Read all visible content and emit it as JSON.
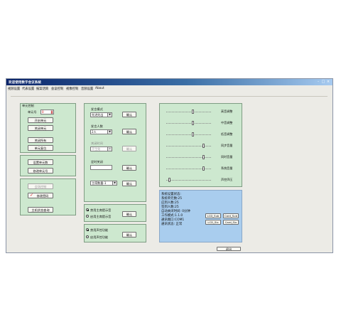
{
  "window": {
    "title": "欢迎使用数字会议系统",
    "minimize": "-",
    "maximize": "□",
    "close": "×"
  },
  "menu": [
    "视频设置",
    "代表设置",
    "报案话筒",
    "会议控制",
    "视像控制",
    "音频设置",
    "About"
  ],
  "unit_panel": {
    "title": "单元控制",
    "unit_no_label": "单元号",
    "unit_no_value": "0",
    "open_unit": "开启单元",
    "close_unit": "关闭单元",
    "close_all": "关闭所有",
    "reset_unit": "单元复位",
    "set_unit_count": "设置单元数",
    "modify_unit_no": "修改单元号",
    "convener_control": "会场控制",
    "change_password": "修改密码",
    "host_status_query": "主机状态查询"
  },
  "mode_panel": {
    "speak_mode_label": "发言模式",
    "speak_mode_value": "先进先出",
    "speak_count_label": "发言人数",
    "speak_count_value": "2人",
    "close_time_label": "关闭时间",
    "close_time_value": "不生效",
    "timer_label": "定时关闭",
    "timer_value": "",
    "host_count_value": "主席数量-1",
    "confirm": "确认",
    "display_opt1": "禁用主席提示音",
    "display_opt2": "启用主席提示音",
    "mic_opt1": "禁用声控功能",
    "mic_opt2": "启用声控功能"
  },
  "audio_panel": {
    "sliders": [
      {
        "label": "高音调整",
        "level": 0.6
      },
      {
        "label": "中音调整",
        "level": 0.6
      },
      {
        "label": "低音调整",
        "level": 0.6
      },
      {
        "label": "同步音量",
        "level": 0.85
      },
      {
        "label": "同时音量",
        "level": 0.85
      },
      {
        "label": "系统音量",
        "level": 0.85
      },
      {
        "label": "声控声压",
        "level": 0.05
      }
    ]
  },
  "status_panel": {
    "lines": [
      "系统设置状态:",
      "系统单元数:25",
      "应到人数:25",
      "签到人数:25",
      "自动关闭时间: 0分钟",
      "工作模式:1.1.0",
      "通讯端口:COM1",
      "通讯状态: 正常"
    ],
    "lcd_btn1": "LCD_Sub",
    "lcd_btn2": "Card_Sub",
    "lcd_btn3": "LCD_Six",
    "lcd_btn4": "Card_Six"
  },
  "bottom_button": "退出",
  "colors": {
    "panel_bg": "#cde8cf",
    "status_bg": "#a9cdee",
    "titlebar": "#0b246a"
  }
}
